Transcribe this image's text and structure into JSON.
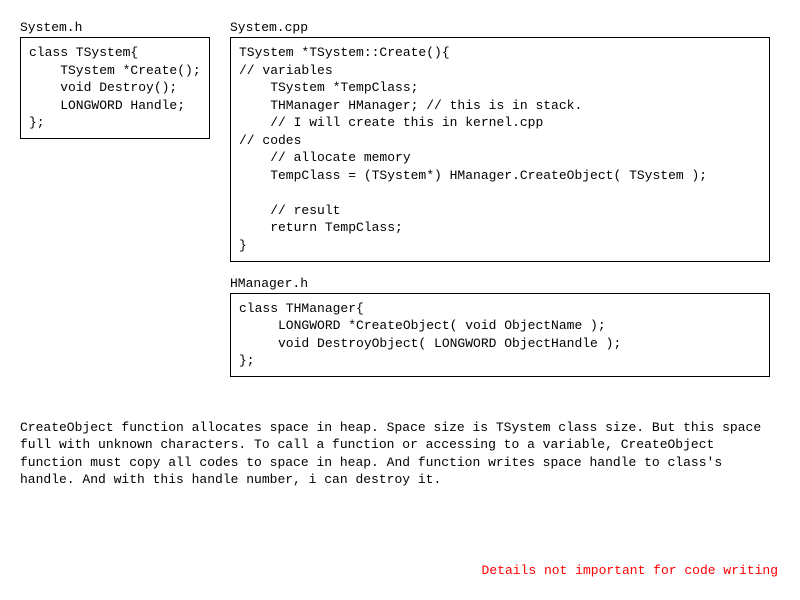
{
  "left": {
    "file_label": "System.h",
    "code": "class TSystem{\n    TSystem *Create();\n    void Destroy();\n    LONGWORD Handle;\n};"
  },
  "right_top": {
    "file_label": "System.cpp",
    "code": "TSystem *TSystem::Create(){\n// variables\n    TSystem *TempClass;\n    THManager HManager; // this is in stack.\n    // I will create this in kernel.cpp\n// codes\n    // allocate memory\n    TempClass = (TSystem*) HManager.CreateObject( TSystem );\n\n    // result\n    return TempClass;\n}"
  },
  "right_bottom": {
    "file_label": "HManager.h",
    "code": "class THManager{\n     LONGWORD *CreateObject( void ObjectName );\n     void DestroyObject( LONGWORD ObjectHandle );\n};"
  },
  "explanation": "CreateObject function allocates space in heap. Space size is TSystem class size. But this space full with unknown characters. To call a function or accessing to a variable, CreateObject function must copy all codes to space in heap. And function writes space handle to class's handle. And with this handle number, i can destroy it.",
  "footnote": "Details not important for code writing"
}
